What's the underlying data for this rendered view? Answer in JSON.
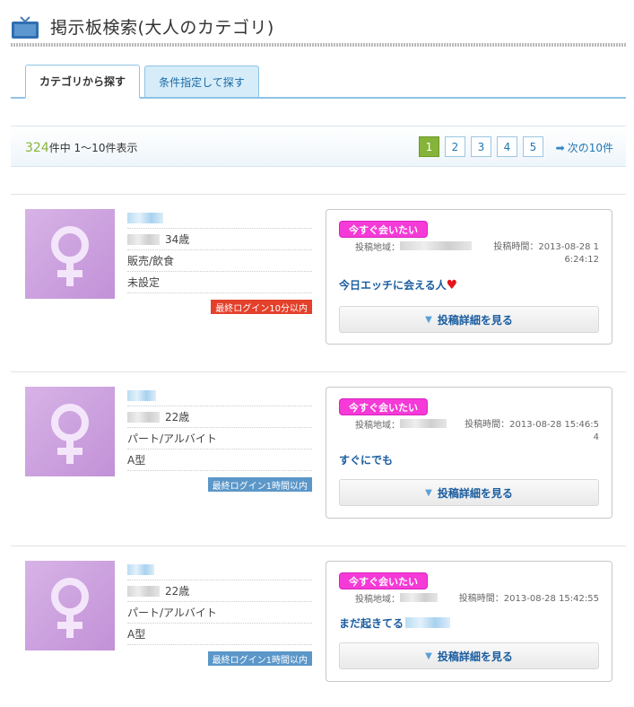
{
  "header": {
    "title": "掲示板検索(大人のカテゴリ)"
  },
  "tabs": [
    {
      "label": "カテゴリから探す",
      "active": true
    },
    {
      "label": "条件指定して探す",
      "active": false
    }
  ],
  "pager": {
    "total": "324",
    "summary_suffix": "件中 1〜10件表示",
    "pages": [
      "1",
      "2",
      "3",
      "4",
      "5"
    ],
    "current_page": "1",
    "next_label": "次の10件"
  },
  "listings": [
    {
      "age": "34歳",
      "job": "販売/飲食",
      "blood": "未設定",
      "login": "最終ログイン10分以内",
      "login_color": "#e4402b",
      "post": {
        "badge": "今すぐ会いたい",
        "area_label": "投稿地域：",
        "time_label": "投稿時間：2013-08-28 1",
        "time_label_2": "6:24:12",
        "title": "今日エッチに会える人",
        "detail": "投稿詳細を見る"
      }
    },
    {
      "age": "22歳",
      "job": "パート/アルバイト",
      "blood": "A型",
      "login": "最終ログイン1時間以内",
      "login_color": "#5b97c9",
      "post": {
        "badge": "今すぐ会いたい",
        "area_label": "投稿地域：",
        "time_label": "投稿時間：2013-08-28 15:46:5",
        "time_label_2": "4",
        "title": "すぐにでも",
        "detail": "投稿詳細を見る"
      }
    },
    {
      "age": "22歳",
      "job": "パート/アルバイト",
      "blood": "A型",
      "login": "最終ログイン1時間以内",
      "login_color": "#5b97c9",
      "post": {
        "badge": "今すぐ会いたい",
        "area_label": "投稿地域：",
        "time_label": "投稿時間：2013-08-28 15:42:55",
        "title": "まだ起きてる",
        "detail": "投稿詳細を見る"
      }
    }
  ],
  "icons": {
    "header": "tv-icon",
    "avatar": "female-symbol-icon",
    "next": "arrow-right-icon",
    "detail": "arrow-down-icon",
    "heart": "heart-icon"
  },
  "colors": {
    "accent_green": "#86b33a",
    "link_blue": "#2277b3",
    "badge_pink": "#f53ad8",
    "login_red": "#e4402b",
    "login_blue": "#5b97c9"
  }
}
